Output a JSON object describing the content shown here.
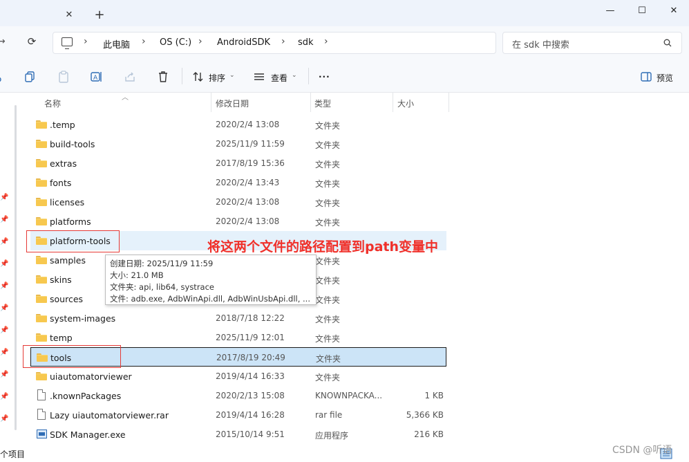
{
  "window": {
    "tab_close_icon": "close-icon",
    "new_tab_icon": "plus-icon",
    "minimize_icon": "minimize-icon",
    "maximize_icon": "maximize-icon",
    "close_icon": "close-icon"
  },
  "address": {
    "breadcrumbs": [
      "此电脑",
      "OS (C:)",
      "AndroidSDK",
      "sdk"
    ],
    "search_placeholder": "在 sdk 中搜索"
  },
  "toolbar": {
    "sort_label": "排序",
    "view_label": "查看",
    "more_label": "···",
    "preview_label": "预览"
  },
  "columns": {
    "name": "名称",
    "date": "修改日期",
    "type": "类型",
    "size": "大小"
  },
  "files": [
    {
      "name": ".temp",
      "date": "2020/2/4 13:08",
      "type": "文件夹",
      "size": "",
      "icon": "folder"
    },
    {
      "name": "build-tools",
      "date": "2025/11/9 11:59",
      "type": "文件夹",
      "size": "",
      "icon": "folder"
    },
    {
      "name": "extras",
      "date": "2017/8/19 15:36",
      "type": "文件夹",
      "size": "",
      "icon": "folder"
    },
    {
      "name": "fonts",
      "date": "2020/2/4 13:43",
      "type": "文件夹",
      "size": "",
      "icon": "folder"
    },
    {
      "name": "licenses",
      "date": "2020/2/4 13:08",
      "type": "文件夹",
      "size": "",
      "icon": "folder"
    },
    {
      "name": "platforms",
      "date": "2020/2/4 13:08",
      "type": "文件夹",
      "size": "",
      "icon": "folder"
    },
    {
      "name": "platform-tools",
      "date": "",
      "type": "",
      "size": "",
      "icon": "folder"
    },
    {
      "name": "samples",
      "date": "",
      "type": "文件夹",
      "size": "",
      "icon": "folder"
    },
    {
      "name": "skins",
      "date": "",
      "type": "文件夹",
      "size": "",
      "icon": "folder"
    },
    {
      "name": "sources",
      "date": "",
      "type": "文件夹",
      "size": "",
      "icon": "folder"
    },
    {
      "name": "system-images",
      "date": "2018/7/18 12:22",
      "type": "文件夹",
      "size": "",
      "icon": "folder"
    },
    {
      "name": "temp",
      "date": "2025/11/9 12:01",
      "type": "文件夹",
      "size": "",
      "icon": "folder"
    },
    {
      "name": "tools",
      "date": "2017/8/19 20:49",
      "type": "文件夹",
      "size": "",
      "icon": "folder"
    },
    {
      "name": "uiautomatorviewer",
      "date": "2019/4/14 16:33",
      "type": "文件夹",
      "size": "",
      "icon": "folder"
    },
    {
      "name": ".knownPackages",
      "date": "2020/2/13 15:08",
      "type": "KNOWNPACKA...",
      "size": "1 KB",
      "icon": "file"
    },
    {
      "name": "Lazy uiautomatorviewer.rar",
      "date": "2019/4/14 16:28",
      "type": "rar file",
      "size": "5,366 KB",
      "icon": "file"
    },
    {
      "name": "SDK Manager.exe",
      "date": "2015/10/14 9:51",
      "type": "应用程序",
      "size": "216 KB",
      "icon": "app"
    }
  ],
  "tooltip": {
    "created": "创建日期: 2025/11/9 11:59",
    "size": "大小: 21.0 MB",
    "folders": "文件夹: api, lib64, systrace",
    "files": "文件: adb.exe, AdbWinApi.dll, AdbWinUsbApi.dll, ..."
  },
  "annotation": "将这两个文件的路径配置到path变量中",
  "status": {
    "count": "个项目"
  },
  "watermark": "CSDN @听语",
  "colors": {
    "annotation_red": "#f0302a",
    "selection_bg": "#cce4f7",
    "folder_yellow": "#f7c84f"
  }
}
